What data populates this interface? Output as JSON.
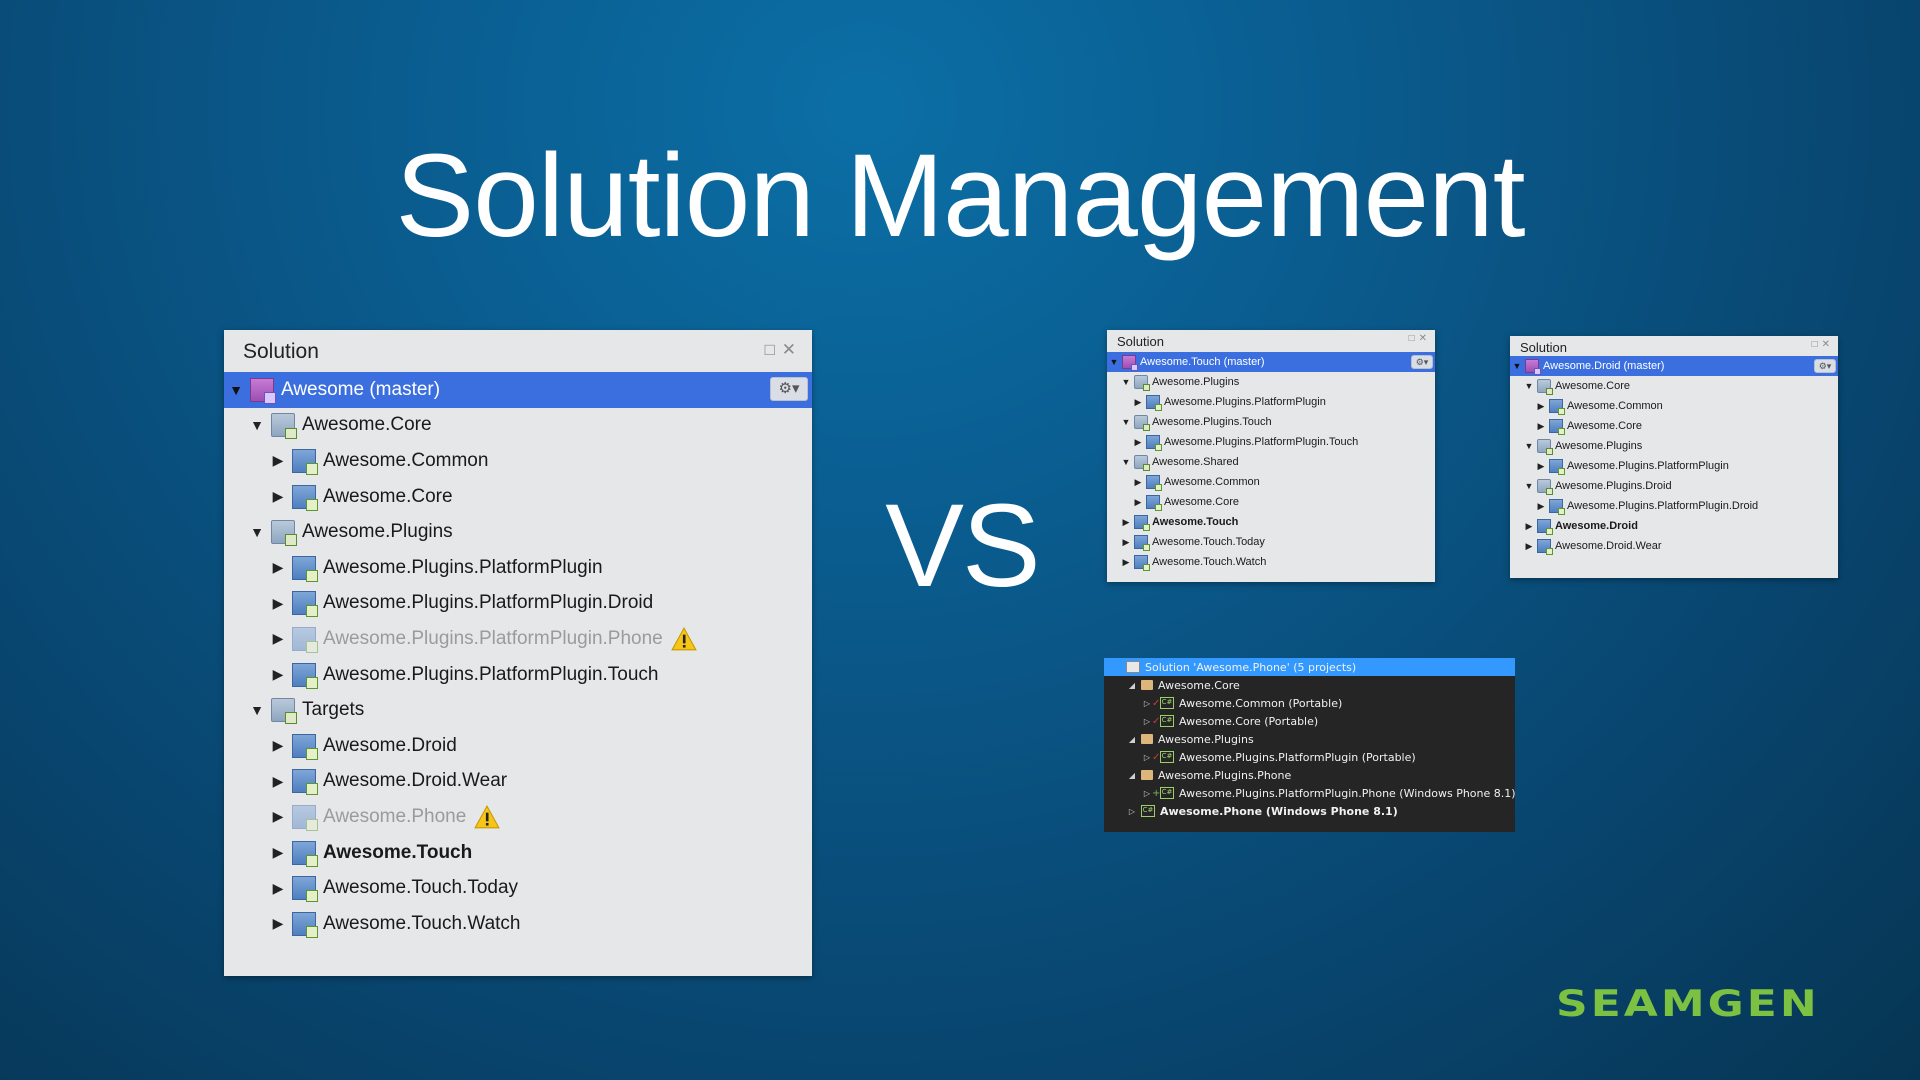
{
  "slide": {
    "title": "Solution Management",
    "vs_label": "VS",
    "logo": "SEAMGEN",
    "colors": {
      "accent_green": "#7cc142",
      "selection_blue": "#3b6fe0",
      "vs_selection": "#3399ff"
    }
  },
  "pad_large": {
    "header": "Solution",
    "buttons": [
      "□",
      "✕"
    ],
    "rows": [
      {
        "label": "Awesome (master)",
        "level": 0,
        "arrow": "▼",
        "icon": "solution-icon",
        "selected": true,
        "gear": "⚙▾"
      },
      {
        "label": "Awesome.Core",
        "level": 1,
        "arrow": "▼",
        "icon": "folder-icon"
      },
      {
        "label": "Awesome.Common",
        "level": 2,
        "arrow": "▶",
        "icon": "project-icon"
      },
      {
        "label": "Awesome.Core",
        "level": 2,
        "arrow": "▶",
        "icon": "project-icon"
      },
      {
        "label": "Awesome.Plugins",
        "level": 1,
        "arrow": "▼",
        "icon": "folder-icon"
      },
      {
        "label": "Awesome.Plugins.PlatformPlugin",
        "level": 2,
        "arrow": "▶",
        "icon": "project-icon"
      },
      {
        "label": "Awesome.Plugins.PlatformPlugin.Droid",
        "level": 2,
        "arrow": "▶",
        "icon": "project-icon"
      },
      {
        "label": "Awesome.Plugins.PlatformPlugin.Phone",
        "level": 2,
        "arrow": "▶",
        "icon": "project-icon",
        "dim": true,
        "warning": true
      },
      {
        "label": "Awesome.Plugins.PlatformPlugin.Touch",
        "level": 2,
        "arrow": "▶",
        "icon": "project-icon"
      },
      {
        "label": "Targets",
        "level": 1,
        "arrow": "▼",
        "icon": "folder-icon"
      },
      {
        "label": "Awesome.Droid",
        "level": 2,
        "arrow": "▶",
        "icon": "project-icon"
      },
      {
        "label": "Awesome.Droid.Wear",
        "level": 2,
        "arrow": "▶",
        "icon": "project-icon"
      },
      {
        "label": "Awesome.Phone",
        "level": 2,
        "arrow": "▶",
        "icon": "project-icon",
        "dim": true,
        "warning": true
      },
      {
        "label": "Awesome.Touch",
        "level": 2,
        "arrow": "▶",
        "icon": "project-icon",
        "bold": true
      },
      {
        "label": "Awesome.Touch.Today",
        "level": 2,
        "arrow": "▶",
        "icon": "project-icon"
      },
      {
        "label": "Awesome.Touch.Watch",
        "level": 2,
        "arrow": "▶",
        "icon": "project-icon"
      }
    ]
  },
  "pad_touch": {
    "header": "Solution",
    "buttons": [
      "□",
      "✕"
    ],
    "rows": [
      {
        "label": "Awesome.Touch (master)",
        "level": 0,
        "arrow": "▼",
        "icon": "solution-icon",
        "selected": true,
        "gear": "⚙▾"
      },
      {
        "label": "Awesome.Plugins",
        "level": 1,
        "arrow": "▼",
        "icon": "folder-icon"
      },
      {
        "label": "Awesome.Plugins.PlatformPlugin",
        "level": 2,
        "arrow": "▶",
        "icon": "project-icon"
      },
      {
        "label": "Awesome.Plugins.Touch",
        "level": 1,
        "arrow": "▼",
        "icon": "folder-icon"
      },
      {
        "label": "Awesome.Plugins.PlatformPlugin.Touch",
        "level": 2,
        "arrow": "▶",
        "icon": "project-icon"
      },
      {
        "label": "Awesome.Shared",
        "level": 1,
        "arrow": "▼",
        "icon": "folder-icon"
      },
      {
        "label": "Awesome.Common",
        "level": 2,
        "arrow": "▶",
        "icon": "project-icon"
      },
      {
        "label": "Awesome.Core",
        "level": 2,
        "arrow": "▶",
        "icon": "project-icon"
      },
      {
        "label": "Awesome.Touch",
        "level": 1,
        "arrow": "▶",
        "icon": "project-icon",
        "bold": true
      },
      {
        "label": "Awesome.Touch.Today",
        "level": 1,
        "arrow": "▶",
        "icon": "project-icon"
      },
      {
        "label": "Awesome.Touch.Watch",
        "level": 1,
        "arrow": "▶",
        "icon": "project-icon"
      }
    ]
  },
  "pad_droid": {
    "header": "Solution",
    "buttons": [
      "□",
      "✕"
    ],
    "rows": [
      {
        "label": "Awesome.Droid (master)",
        "level": 0,
        "arrow": "▼",
        "icon": "solution-icon",
        "selected": true,
        "gear": "⚙▾"
      },
      {
        "label": "Awesome.Core",
        "level": 1,
        "arrow": "▼",
        "icon": "folder-icon"
      },
      {
        "label": "Awesome.Common",
        "level": 2,
        "arrow": "▶",
        "icon": "project-icon"
      },
      {
        "label": "Awesome.Core",
        "level": 2,
        "arrow": "▶",
        "icon": "project-icon"
      },
      {
        "label": "Awesome.Plugins",
        "level": 1,
        "arrow": "▼",
        "icon": "folder-icon"
      },
      {
        "label": "Awesome.Plugins.PlatformPlugin",
        "level": 2,
        "arrow": "▶",
        "icon": "project-icon"
      },
      {
        "label": "Awesome.Plugins.Droid",
        "level": 1,
        "arrow": "▼",
        "icon": "folder-icon"
      },
      {
        "label": "Awesome.Plugins.PlatformPlugin.Droid",
        "level": 2,
        "arrow": "▶",
        "icon": "project-icon"
      },
      {
        "label": "Awesome.Droid",
        "level": 1,
        "arrow": "▶",
        "icon": "project-icon",
        "bold": true
      },
      {
        "label": "Awesome.Droid.Wear",
        "level": 1,
        "arrow": "▶",
        "icon": "project-icon"
      }
    ]
  },
  "vs_explorer": {
    "rows": [
      {
        "label": "Solution 'Awesome.Phone' (5 projects)",
        "level": 0,
        "arrow": "",
        "icon": "vs-solution-icon",
        "selected": true
      },
      {
        "label": "Awesome.Core",
        "level": 1,
        "arrow": "◢",
        "icon": "vs-folder-icon"
      },
      {
        "label": "Awesome.Common (Portable)",
        "level": 2,
        "arrow": "▷",
        "icon": "vs-csharp-project-icon",
        "mark": "✓"
      },
      {
        "label": "Awesome.Core (Portable)",
        "level": 2,
        "arrow": "▷",
        "icon": "vs-csharp-project-icon",
        "mark": "✓"
      },
      {
        "label": "Awesome.Plugins",
        "level": 1,
        "arrow": "◢",
        "icon": "vs-folder-icon"
      },
      {
        "label": "Awesome.Plugins.PlatformPlugin (Portable)",
        "level": 2,
        "arrow": "▷",
        "icon": "vs-csharp-project-icon",
        "mark": "✓"
      },
      {
        "label": "Awesome.Plugins.Phone",
        "level": 1,
        "arrow": "◢",
        "icon": "vs-folder-icon"
      },
      {
        "label": "Awesome.Plugins.PlatformPlugin.Phone (Windows Phone 8.1)",
        "level": 2,
        "arrow": "▷",
        "icon": "vs-csharp-project-icon",
        "mark": "+"
      },
      {
        "label": "Awesome.Phone (Windows Phone 8.1)",
        "level": 1,
        "arrow": "▷",
        "icon": "vs-csharp-project-icon",
        "bold": true
      }
    ],
    "icon_text": "C#"
  }
}
